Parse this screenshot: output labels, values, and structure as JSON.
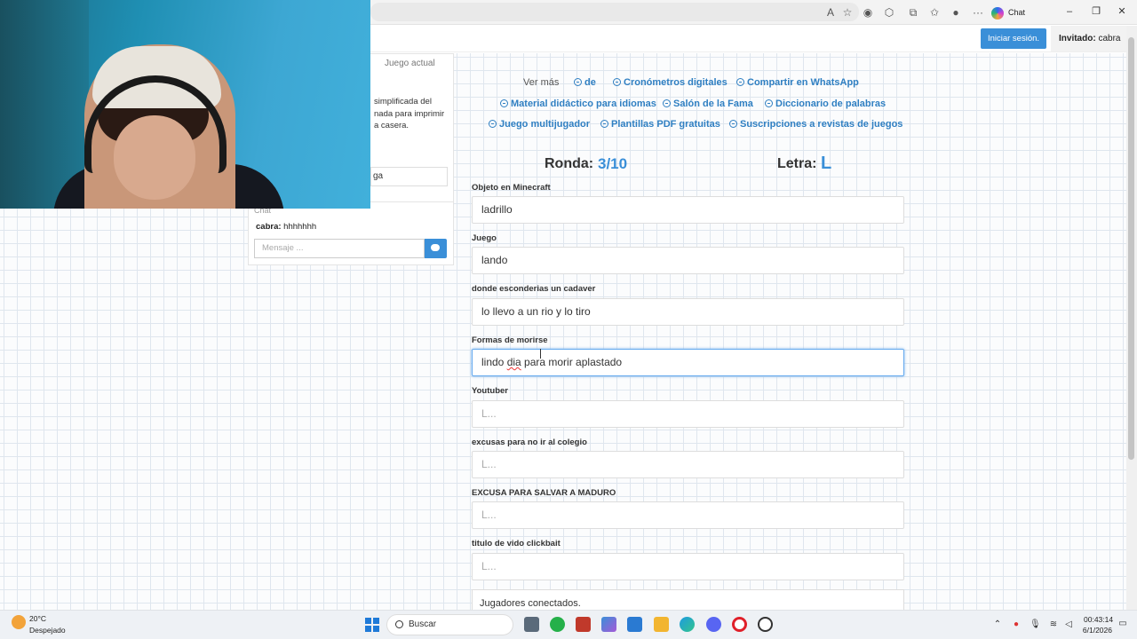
{
  "browser": {
    "chat_label": "Chat",
    "icons": [
      "read-aloud-icon",
      "favorite-star-icon",
      "extension-icon",
      "extensions-icon",
      "favorites-icon",
      "profile-icon",
      "more-icon"
    ]
  },
  "header": {
    "login_label": "Iniciar sesión.",
    "guest_prefix": "Invitado:",
    "guest_name": "cabra"
  },
  "left_panel": {
    "current_game_tab": "Juego actual",
    "description": "simplificada del\nnada para imprimir\na casera.",
    "share_field_value": "ga",
    "chat_title": "Chat",
    "chat_message_user": "cabra:",
    "chat_message_text": "hhhhhhh",
    "message_placeholder": "Mensaje ..."
  },
  "tags": {
    "see_more": "Ver más",
    "row1": [
      "de",
      "Cronómetros digitales",
      "Compartir en WhatsApp"
    ],
    "row2": [
      "Material didáctico para idiomas",
      "Salón de la Fama",
      "Diccionario de palabras"
    ],
    "row3": [
      "Juego multijugador",
      "Plantillas PDF gratuitas",
      "Suscripciones a revistas de juegos"
    ]
  },
  "game": {
    "round_label": "Ronda:",
    "round_value": "3/10",
    "letter_label": "Letra:",
    "letter_value": "L",
    "fields": [
      {
        "label": "Objeto en Minecraft",
        "value": "ladrillo",
        "placeholder": "L..."
      },
      {
        "label": "Juego",
        "value": "lando",
        "placeholder": "L..."
      },
      {
        "label": "donde esconderias un cadaver",
        "value": "lo llevo a un rio y lo tiro",
        "placeholder": "L..."
      },
      {
        "label": "Formas de morirse",
        "value_before": "lindo ",
        "value_spell": "dia",
        "value_after": " para morir aplastado",
        "placeholder": "L..."
      },
      {
        "label": "Youtuber",
        "value": "",
        "placeholder": "L..."
      },
      {
        "label": "excusas para no ir al colegio",
        "value": "",
        "placeholder": "L..."
      },
      {
        "label": "EXCUSA PARA SALVAR A MADURO",
        "value": "",
        "placeholder": "L..."
      },
      {
        "label": "titulo de vido clickbait",
        "value": "",
        "placeholder": "L..."
      }
    ],
    "players_connected": "Jugadores conectados."
  },
  "taskbar": {
    "temperature": "20°C",
    "weather": "Despejado",
    "search_label": "Buscar",
    "time": "00:43:14",
    "date": "6/1/2026"
  },
  "colors": {
    "accent": "#3a8fd8",
    "link": "#2f7fc2"
  }
}
